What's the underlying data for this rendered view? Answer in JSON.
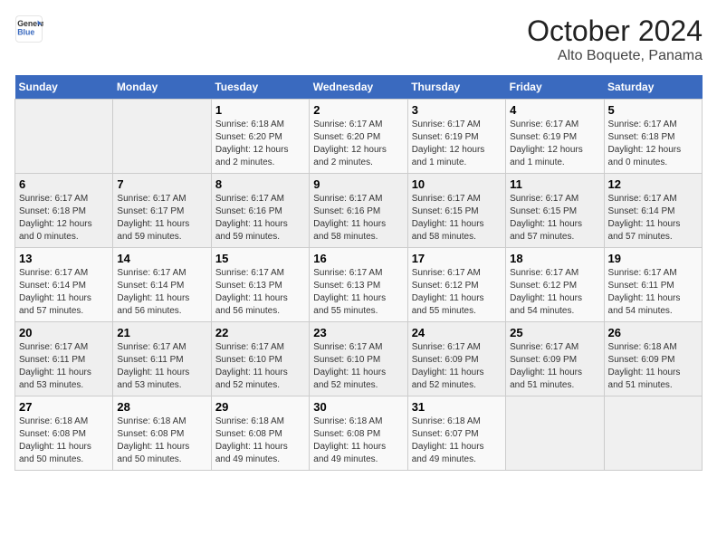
{
  "logo": {
    "line1": "General",
    "line2": "Blue"
  },
  "title": "October 2024",
  "subtitle": "Alto Boquete, Panama",
  "days_of_week": [
    "Sunday",
    "Monday",
    "Tuesday",
    "Wednesday",
    "Thursday",
    "Friday",
    "Saturday"
  ],
  "weeks": [
    [
      {
        "num": "",
        "info": ""
      },
      {
        "num": "",
        "info": ""
      },
      {
        "num": "1",
        "info": "Sunrise: 6:18 AM\nSunset: 6:20 PM\nDaylight: 12 hours\nand 2 minutes."
      },
      {
        "num": "2",
        "info": "Sunrise: 6:17 AM\nSunset: 6:20 PM\nDaylight: 12 hours\nand 2 minutes."
      },
      {
        "num": "3",
        "info": "Sunrise: 6:17 AM\nSunset: 6:19 PM\nDaylight: 12 hours\nand 1 minute."
      },
      {
        "num": "4",
        "info": "Sunrise: 6:17 AM\nSunset: 6:19 PM\nDaylight: 12 hours\nand 1 minute."
      },
      {
        "num": "5",
        "info": "Sunrise: 6:17 AM\nSunset: 6:18 PM\nDaylight: 12 hours\nand 0 minutes."
      }
    ],
    [
      {
        "num": "6",
        "info": "Sunrise: 6:17 AM\nSunset: 6:18 PM\nDaylight: 12 hours\nand 0 minutes."
      },
      {
        "num": "7",
        "info": "Sunrise: 6:17 AM\nSunset: 6:17 PM\nDaylight: 11 hours\nand 59 minutes."
      },
      {
        "num": "8",
        "info": "Sunrise: 6:17 AM\nSunset: 6:16 PM\nDaylight: 11 hours\nand 59 minutes."
      },
      {
        "num": "9",
        "info": "Sunrise: 6:17 AM\nSunset: 6:16 PM\nDaylight: 11 hours\nand 58 minutes."
      },
      {
        "num": "10",
        "info": "Sunrise: 6:17 AM\nSunset: 6:15 PM\nDaylight: 11 hours\nand 58 minutes."
      },
      {
        "num": "11",
        "info": "Sunrise: 6:17 AM\nSunset: 6:15 PM\nDaylight: 11 hours\nand 57 minutes."
      },
      {
        "num": "12",
        "info": "Sunrise: 6:17 AM\nSunset: 6:14 PM\nDaylight: 11 hours\nand 57 minutes."
      }
    ],
    [
      {
        "num": "13",
        "info": "Sunrise: 6:17 AM\nSunset: 6:14 PM\nDaylight: 11 hours\nand 57 minutes."
      },
      {
        "num": "14",
        "info": "Sunrise: 6:17 AM\nSunset: 6:14 PM\nDaylight: 11 hours\nand 56 minutes."
      },
      {
        "num": "15",
        "info": "Sunrise: 6:17 AM\nSunset: 6:13 PM\nDaylight: 11 hours\nand 56 minutes."
      },
      {
        "num": "16",
        "info": "Sunrise: 6:17 AM\nSunset: 6:13 PM\nDaylight: 11 hours\nand 55 minutes."
      },
      {
        "num": "17",
        "info": "Sunrise: 6:17 AM\nSunset: 6:12 PM\nDaylight: 11 hours\nand 55 minutes."
      },
      {
        "num": "18",
        "info": "Sunrise: 6:17 AM\nSunset: 6:12 PM\nDaylight: 11 hours\nand 54 minutes."
      },
      {
        "num": "19",
        "info": "Sunrise: 6:17 AM\nSunset: 6:11 PM\nDaylight: 11 hours\nand 54 minutes."
      }
    ],
    [
      {
        "num": "20",
        "info": "Sunrise: 6:17 AM\nSunset: 6:11 PM\nDaylight: 11 hours\nand 53 minutes."
      },
      {
        "num": "21",
        "info": "Sunrise: 6:17 AM\nSunset: 6:11 PM\nDaylight: 11 hours\nand 53 minutes."
      },
      {
        "num": "22",
        "info": "Sunrise: 6:17 AM\nSunset: 6:10 PM\nDaylight: 11 hours\nand 52 minutes."
      },
      {
        "num": "23",
        "info": "Sunrise: 6:17 AM\nSunset: 6:10 PM\nDaylight: 11 hours\nand 52 minutes."
      },
      {
        "num": "24",
        "info": "Sunrise: 6:17 AM\nSunset: 6:09 PM\nDaylight: 11 hours\nand 52 minutes."
      },
      {
        "num": "25",
        "info": "Sunrise: 6:17 AM\nSunset: 6:09 PM\nDaylight: 11 hours\nand 51 minutes."
      },
      {
        "num": "26",
        "info": "Sunrise: 6:18 AM\nSunset: 6:09 PM\nDaylight: 11 hours\nand 51 minutes."
      }
    ],
    [
      {
        "num": "27",
        "info": "Sunrise: 6:18 AM\nSunset: 6:08 PM\nDaylight: 11 hours\nand 50 minutes."
      },
      {
        "num": "28",
        "info": "Sunrise: 6:18 AM\nSunset: 6:08 PM\nDaylight: 11 hours\nand 50 minutes."
      },
      {
        "num": "29",
        "info": "Sunrise: 6:18 AM\nSunset: 6:08 PM\nDaylight: 11 hours\nand 49 minutes."
      },
      {
        "num": "30",
        "info": "Sunrise: 6:18 AM\nSunset: 6:08 PM\nDaylight: 11 hours\nand 49 minutes."
      },
      {
        "num": "31",
        "info": "Sunrise: 6:18 AM\nSunset: 6:07 PM\nDaylight: 11 hours\nand 49 minutes."
      },
      {
        "num": "",
        "info": ""
      },
      {
        "num": "",
        "info": ""
      }
    ]
  ]
}
